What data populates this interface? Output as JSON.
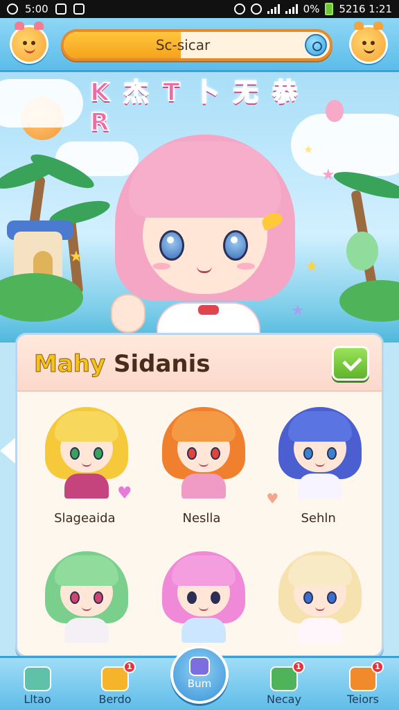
{
  "status_bar": {
    "time": "5:00",
    "battery": "0%",
    "right_text": "5216 1:21"
  },
  "top_bar": {
    "search_label": "Sc-sicar",
    "search_progress": 0.44
  },
  "scene": {
    "title": "K 杰 T 卜 无 恭 R"
  },
  "panel": {
    "title_accent": "Mahy",
    "title_rest": " Sidanis",
    "characters": [
      {
        "name": "Slageaida",
        "hair": "#f5c93a",
        "bangs": "#f8d85c",
        "eyes": "#3aa35a",
        "body": "#c6447e"
      },
      {
        "name": "Neslla",
        "hair": "#f0802e",
        "bangs": "#f59a44",
        "eyes": "#e0443a",
        "body": "#f09ac6"
      },
      {
        "name": "Sehln",
        "hair": "#4b5fd0",
        "bangs": "#5a74e2",
        "eyes": "#3a82d0",
        "body": "#f8f4ff"
      },
      {
        "name": "",
        "hair": "#7bcf8c",
        "bangs": "#8fdc9c",
        "eyes": "#d0446e",
        "body": "#f5f0f6"
      },
      {
        "name": "",
        "hair": "#f08ad8",
        "bangs": "#f49ee0",
        "eyes": "#2a2f55",
        "body": "#cde6ff"
      },
      {
        "name": "",
        "hair": "#f5e2ae",
        "bangs": "#f8eac4",
        "eyes": "#3a6fd0",
        "body": "#fff6fb"
      }
    ]
  },
  "bottom_nav": [
    {
      "label": "Lltao",
      "icon": "map-icon",
      "badge": "",
      "color": "#5fc2a8"
    },
    {
      "label": "Berdo",
      "icon": "gift-icon",
      "badge": "1",
      "color": "#f5b42a"
    },
    {
      "label": "Bum",
      "icon": "home-icon",
      "badge": "",
      "color": "#7b6fe0"
    },
    {
      "label": "Necay",
      "icon": "chat-icon",
      "badge": "1",
      "color": "#4fb35a"
    },
    {
      "label": "Teiors",
      "icon": "ticket-icon",
      "badge": "1",
      "color": "#f08a2a"
    }
  ],
  "notifications": {
    "top_right_badge": ""
  }
}
